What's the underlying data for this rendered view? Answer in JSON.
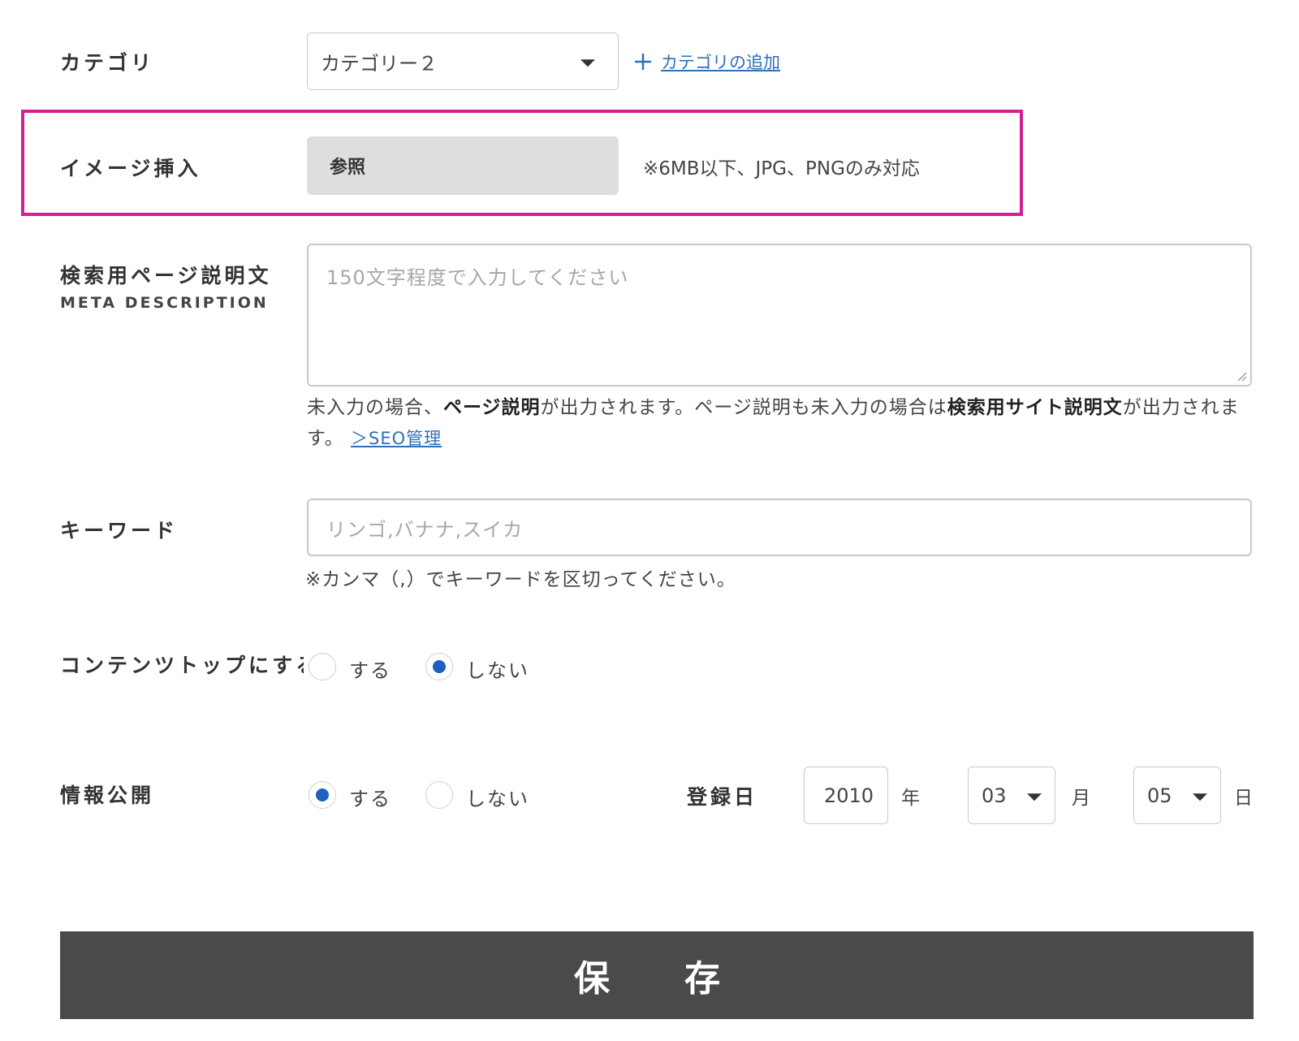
{
  "category": {
    "label": "カテゴリ",
    "selected": "カテゴリー２",
    "add_icon": "plus-icon",
    "add_link": "カテゴリの追加"
  },
  "image_insert": {
    "label": "イメージ挿入",
    "browse_button": "参照",
    "note": "※6MB以下、JPG、PNGのみ対応",
    "highlight_color": "#d3218f"
  },
  "meta_description": {
    "label": "検索用ページ説明文",
    "sub_label": "META DESCRIPTION",
    "placeholder": "150文字程度で入力してください",
    "help_part1": "未入力の場合、",
    "help_bold1": "ページ説明",
    "help_part2": "が出力されます。ページ説明も未入力の場合は",
    "help_bold2": "検索用サイト説明文",
    "help_part3": "が出力されます。",
    "help_link": "＞SEO管理"
  },
  "keyword": {
    "label": "キーワード",
    "placeholder": "リンゴ,バナナ,スイカ",
    "help": "※カンマ（,）でキーワードを区切ってください。"
  },
  "content_top": {
    "label": "コンテンツトップにする",
    "options": [
      {
        "label": "する",
        "checked": false
      },
      {
        "label": "しない",
        "checked": true
      }
    ]
  },
  "publish": {
    "label": "情報公開",
    "options": [
      {
        "label": "する",
        "checked": true
      },
      {
        "label": "しない",
        "checked": false
      }
    ]
  },
  "registration_date": {
    "label": "登録日",
    "year": "2010",
    "year_unit": "年",
    "month": "03",
    "month_unit": "月",
    "day": "05",
    "day_unit": "日"
  },
  "save_button": "保　存",
  "colors": {
    "accent_radio": "#1f5fbf",
    "link": "#2f6fb5",
    "save_bg": "#4a4a4a",
    "browse_bg": "#dedede"
  }
}
